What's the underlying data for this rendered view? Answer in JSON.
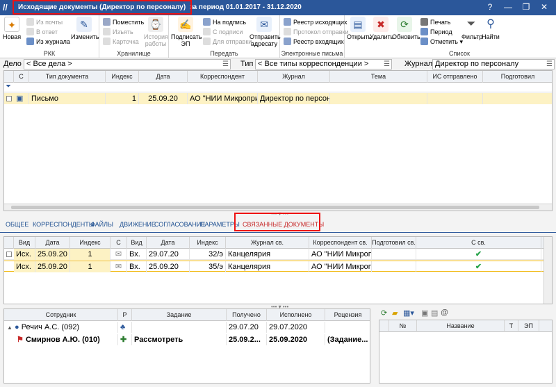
{
  "window": {
    "title": "Исходящие документы (Директор по персоналу)",
    "period": "за период 01.01.2017 - 31.12.2020",
    "controls": [
      "?",
      "—",
      "❐",
      "✕"
    ]
  },
  "ribbon": {
    "groups": [
      {
        "label": "РКК",
        "big": [
          {
            "label": "Новая",
            "icon": "new-doc-icon"
          }
        ],
        "small": [
          {
            "label": "Из почты",
            "enabled": false
          },
          {
            "label": "В ответ",
            "enabled": false
          },
          {
            "label": "Из журнала",
            "enabled": true
          }
        ],
        "big2": [
          {
            "label": "Изменить",
            "icon": "edit-icon"
          }
        ]
      },
      {
        "label": "Хранилище",
        "small": [
          {
            "label": "Поместить",
            "enabled": true
          },
          {
            "label": "Изъять",
            "enabled": false
          },
          {
            "label": "Карточка",
            "enabled": false
          }
        ],
        "big": [
          {
            "label": "История работы",
            "icon": "history-icon",
            "enabled": false
          }
        ]
      },
      {
        "label": "Передать",
        "big": [
          {
            "label": "Подписать ЭП",
            "icon": "sign-icon"
          }
        ],
        "small": [
          {
            "label": "На подпись",
            "enabled": true
          },
          {
            "label": "С подписи",
            "enabled": false
          },
          {
            "label": "Для отправки",
            "enabled": false
          }
        ],
        "big2": [
          {
            "label": "Отправить адресату",
            "icon": "send-icon"
          }
        ]
      },
      {
        "label": "Электронные письма",
        "small": [
          {
            "label": "Реестр исходящих",
            "enabled": true
          },
          {
            "label": "Протокол отправки",
            "enabled": false
          },
          {
            "label": "Реестр входящих",
            "enabled": true
          }
        ]
      },
      {
        "label": "",
        "big": [
          {
            "label": "Открыть",
            "icon": "open-icon"
          },
          {
            "label": "Удалить",
            "icon": "delete-icon"
          },
          {
            "label": "Обновить",
            "icon": "refresh-icon"
          }
        ]
      },
      {
        "label": "Список",
        "small": [
          {
            "label": "Печать",
            "enabled": true
          },
          {
            "label": "Период",
            "enabled": true
          },
          {
            "label": "Отметить",
            "enabled": true
          }
        ],
        "big": [
          {
            "label": "Фильтр",
            "icon": "filter-icon"
          },
          {
            "label": "Найти",
            "icon": "search-icon"
          }
        ]
      }
    ]
  },
  "filters": {
    "delo_label": "Дело",
    "delo_value": "< Все дела >",
    "tip_label": "Тип",
    "tip_value": "< Все типы корреспонденции >",
    "journal_label": "Журнал",
    "journal_value": "Директор по персоналу"
  },
  "main_table": {
    "headers": [
      "С",
      "Тип документа",
      "Индекс",
      "Дата",
      "Корреспондент",
      "Журнал",
      "Тема",
      "ИС отправлено",
      "Подготовил"
    ],
    "rows": [
      {
        "type": "Письмо",
        "index": "1",
        "date": "25.09.20",
        "correspondent": "АО \"НИИ Микропри",
        "journal": "Директор по персон",
        "theme": "",
        "is_sent": "",
        "prepared": ""
      }
    ]
  },
  "tabs": [
    "ОБЩЕЕ",
    "КОРРЕСПОНДЕНТЫ",
    "ФАЙЛЫ",
    "ДВИЖЕНИЕ",
    "СОГЛАСОВАНИЕ",
    "ПАРАМЕТРЫ",
    "СВЯЗАННЫЕ ДОКУМЕНТЫ"
  ],
  "active_tab": "СВЯЗАННЫЕ ДОКУМЕНТЫ",
  "linked_table": {
    "headers": [
      "Вид",
      "Дата",
      "Индекс",
      "С",
      "Вид",
      "Дата",
      "Индекс",
      "Журнал св.",
      "Корреспондент св.",
      "Подготовил св.",
      "С св."
    ],
    "rows": [
      {
        "vid": "Исх.",
        "date": "25.09.20",
        "index": "1",
        "vid2": "Вх.",
        "date2": "29.07.20",
        "index2": "32/э",
        "journal": "Канцелярия",
        "corr": "АО \"НИИ Микроп",
        "prepared": "",
        "ok": "✔"
      },
      {
        "vid": "Исх.",
        "date": "25.09.20",
        "index": "1",
        "vid2": "Вх.",
        "date2": "25.09.20",
        "index2": "35/э",
        "journal": "Канцелярия",
        "corr": "АО \"НИИ Микроп",
        "prepared": "",
        "ok": "✔"
      }
    ]
  },
  "route_table": {
    "headers": [
      "Сотрудник",
      "Р",
      "Задание",
      "Получено",
      "Исполнено",
      "Рецензия"
    ],
    "rows": [
      {
        "employee": "Речич А.С. (092)",
        "task": "",
        "received": "29.07.20",
        "done": "29.07.2020",
        "review": "",
        "bold": false
      },
      {
        "employee": "Смирнов А.Ю. (010)",
        "task": "Рассмотреть",
        "received": "25.09.2...",
        "done": "25.09.2020",
        "review": "(Задание...",
        "bold": true
      }
    ]
  },
  "files_table": {
    "headers": [
      "№",
      "Название",
      "Т",
      "ЭП"
    ]
  }
}
